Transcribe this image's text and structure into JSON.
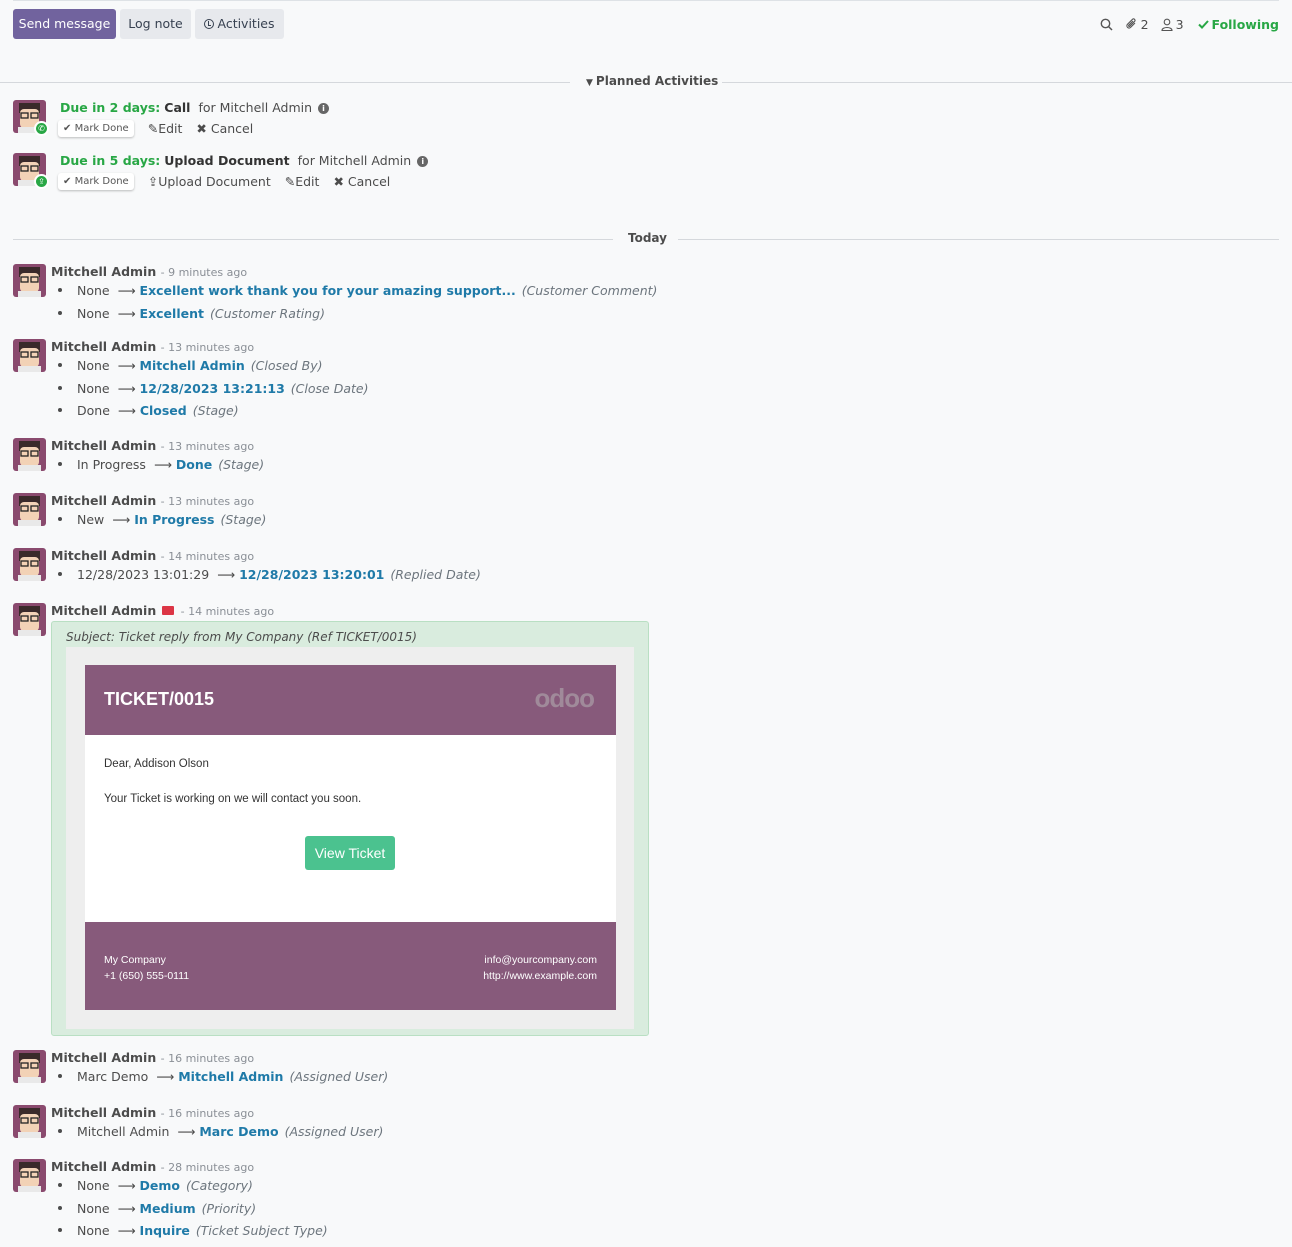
{
  "toolbar": {
    "send_message": "Send message",
    "log_note": "Log note",
    "activities": "Activities",
    "attachments_count": "2",
    "followers_count": "3",
    "following": "Following"
  },
  "planned": {
    "label": "Planned Activities",
    "items": [
      {
        "due": "Due in 2 days:",
        "type": "Call",
        "for": "for Mitchell Admin",
        "mark_done": "Mark Done",
        "actions": [
          "Edit",
          "Cancel"
        ],
        "icon": "phone-icon"
      },
      {
        "due": "Due in 5 days:",
        "type": "Upload Document",
        "for": "for Mitchell Admin",
        "mark_done": "Mark Done",
        "actions": [
          "Upload Document",
          "Edit",
          "Cancel"
        ],
        "icon": "upload-icon"
      }
    ]
  },
  "today_label": "Today",
  "messages": [
    {
      "author": "Mitchell Admin",
      "date": "- 9 minutes ago",
      "tracks": [
        {
          "old": "None",
          "new": "Excellent work thank you for your amazing support...",
          "field": "(Customer Comment)"
        },
        {
          "old": "None",
          "new": "Excellent",
          "field": "(Customer Rating)"
        }
      ]
    },
    {
      "author": "Mitchell Admin",
      "date": "- 13 minutes ago",
      "tracks": [
        {
          "old": "None",
          "new": "Mitchell Admin",
          "field": "(Closed By)"
        },
        {
          "old": "None",
          "new": "12/28/2023 13:21:13",
          "field": "(Close Date)"
        },
        {
          "old": "Done",
          "new": "Closed",
          "field": "(Stage)"
        }
      ]
    },
    {
      "author": "Mitchell Admin",
      "date": "- 13 minutes ago",
      "tracks": [
        {
          "old": "In Progress",
          "new": "Done",
          "field": "(Stage)"
        }
      ]
    },
    {
      "author": "Mitchell Admin",
      "date": "- 13 minutes ago",
      "tracks": [
        {
          "old": "New",
          "new": "In Progress",
          "field": "(Stage)"
        }
      ]
    },
    {
      "author": "Mitchell Admin",
      "date": "- 14 minutes ago",
      "tracks": [
        {
          "old": "12/28/2023 13:01:29",
          "new": "12/28/2023 13:20:01",
          "field": "(Replied Date)"
        }
      ]
    },
    {
      "author": "Mitchell Admin",
      "date": "- 14 minutes ago",
      "tracks": []
    },
    {
      "author": "Mitchell Admin",
      "date": "- 16 minutes ago",
      "tracks": [
        {
          "old": "Marc Demo",
          "new": "Mitchell Admin",
          "field": "(Assigned User)"
        }
      ]
    },
    {
      "author": "Mitchell Admin",
      "date": "- 16 minutes ago",
      "tracks": [
        {
          "old": "Mitchell Admin",
          "new": "Marc Demo",
          "field": "(Assigned User)"
        }
      ]
    },
    {
      "author": "Mitchell Admin",
      "date": "- 28 minutes ago",
      "tracks": [
        {
          "old": "None",
          "new": "Demo",
          "field": "(Category)"
        },
        {
          "old": "None",
          "new": "Medium",
          "field": "(Priority)"
        },
        {
          "old": "None",
          "new": "Inquire",
          "field": "(Ticket Subject Type)"
        }
      ]
    }
  ],
  "email": {
    "subject": "Subject: Ticket reply from My Company (Ref TICKET/0015)",
    "ticket": "TICKET/0015",
    "logo": "odoo",
    "greeting": "Dear, Addison Olson",
    "body": "Your Ticket is working on we will contact you soon.",
    "button": "View Ticket",
    "footer_company": "My Company",
    "footer_phone": "+1 (650) 555-0111",
    "footer_email": "info@yourcompany.com",
    "footer_web": "http://www.example.com"
  },
  "colors": {
    "primary": "#71639e",
    "success": "#28a745",
    "link": "#1f7aa8",
    "email_brand": "#875a7b"
  }
}
